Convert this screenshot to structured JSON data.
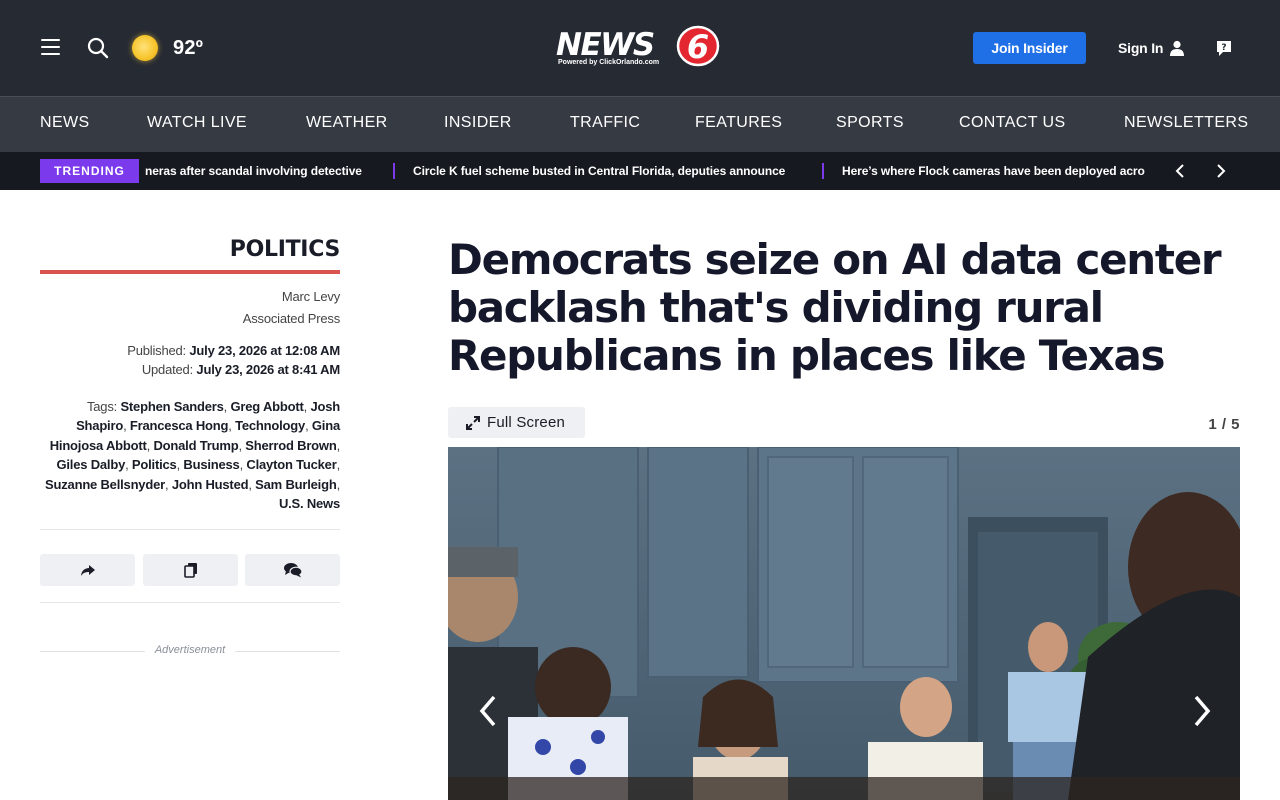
{
  "header": {
    "weather_temp": "92º",
    "logo_text": "NEWS",
    "logo_number": "6",
    "logo_tagline": "Powered by ClickOrlando.com",
    "join_label": "Join Insider",
    "signin_label": "Sign In",
    "icons": [
      "menu-icon",
      "search-icon",
      "sun-icon",
      "user-icon",
      "help-icon"
    ]
  },
  "nav": {
    "items": [
      "NEWS",
      "WATCH LIVE",
      "WEATHER",
      "INSIDER",
      "TRAFFIC",
      "FEATURES",
      "SPORTS",
      "CONTACT US",
      "NEWSLETTERS"
    ]
  },
  "trending": {
    "label": "TRENDING",
    "items": [
      "neras after scandal involving detective",
      "Circle K fuel scheme busted in Central Florida, deputies announce",
      "Here’s where Flock cameras have been deployed acro"
    ]
  },
  "article": {
    "section": "POLITICS",
    "author": "Marc Levy",
    "source": "Associated Press",
    "published_label": "Published:",
    "published_value": "July 23, 2026 at 12:08 AM",
    "updated_label": "Updated:",
    "updated_value": "July 23, 2026 at 8:41 AM",
    "tags_label": "Tags:",
    "tags": [
      "Stephen Sanders",
      "Greg Abbott",
      "Josh Shapiro",
      "Francesca Hong",
      "Technology",
      "Gina Hinojosa Abbott",
      "Donald Trump",
      "Sherrod Brown",
      "Giles Dalby",
      "Politics",
      "Business",
      "Clayton Tucker",
      "Suzanne Bellsnyder",
      "John Husted",
      "Sam Burleigh",
      "U.S. News"
    ],
    "headline": "Democrats seize on AI data center backlash that's dividing rural Republicans in places like Texas",
    "advertisement_label": "Advertisement"
  },
  "gallery": {
    "fullscreen_label": "Full Screen",
    "counter": "1 / 5"
  },
  "colors": {
    "header_bg": "#262a33",
    "nav_bg": "#363a43",
    "trending_bg": "#16191f",
    "accent_purple": "#7c3aed",
    "accent_blue": "#1f6fe6",
    "section_red": "#d9534f"
  }
}
